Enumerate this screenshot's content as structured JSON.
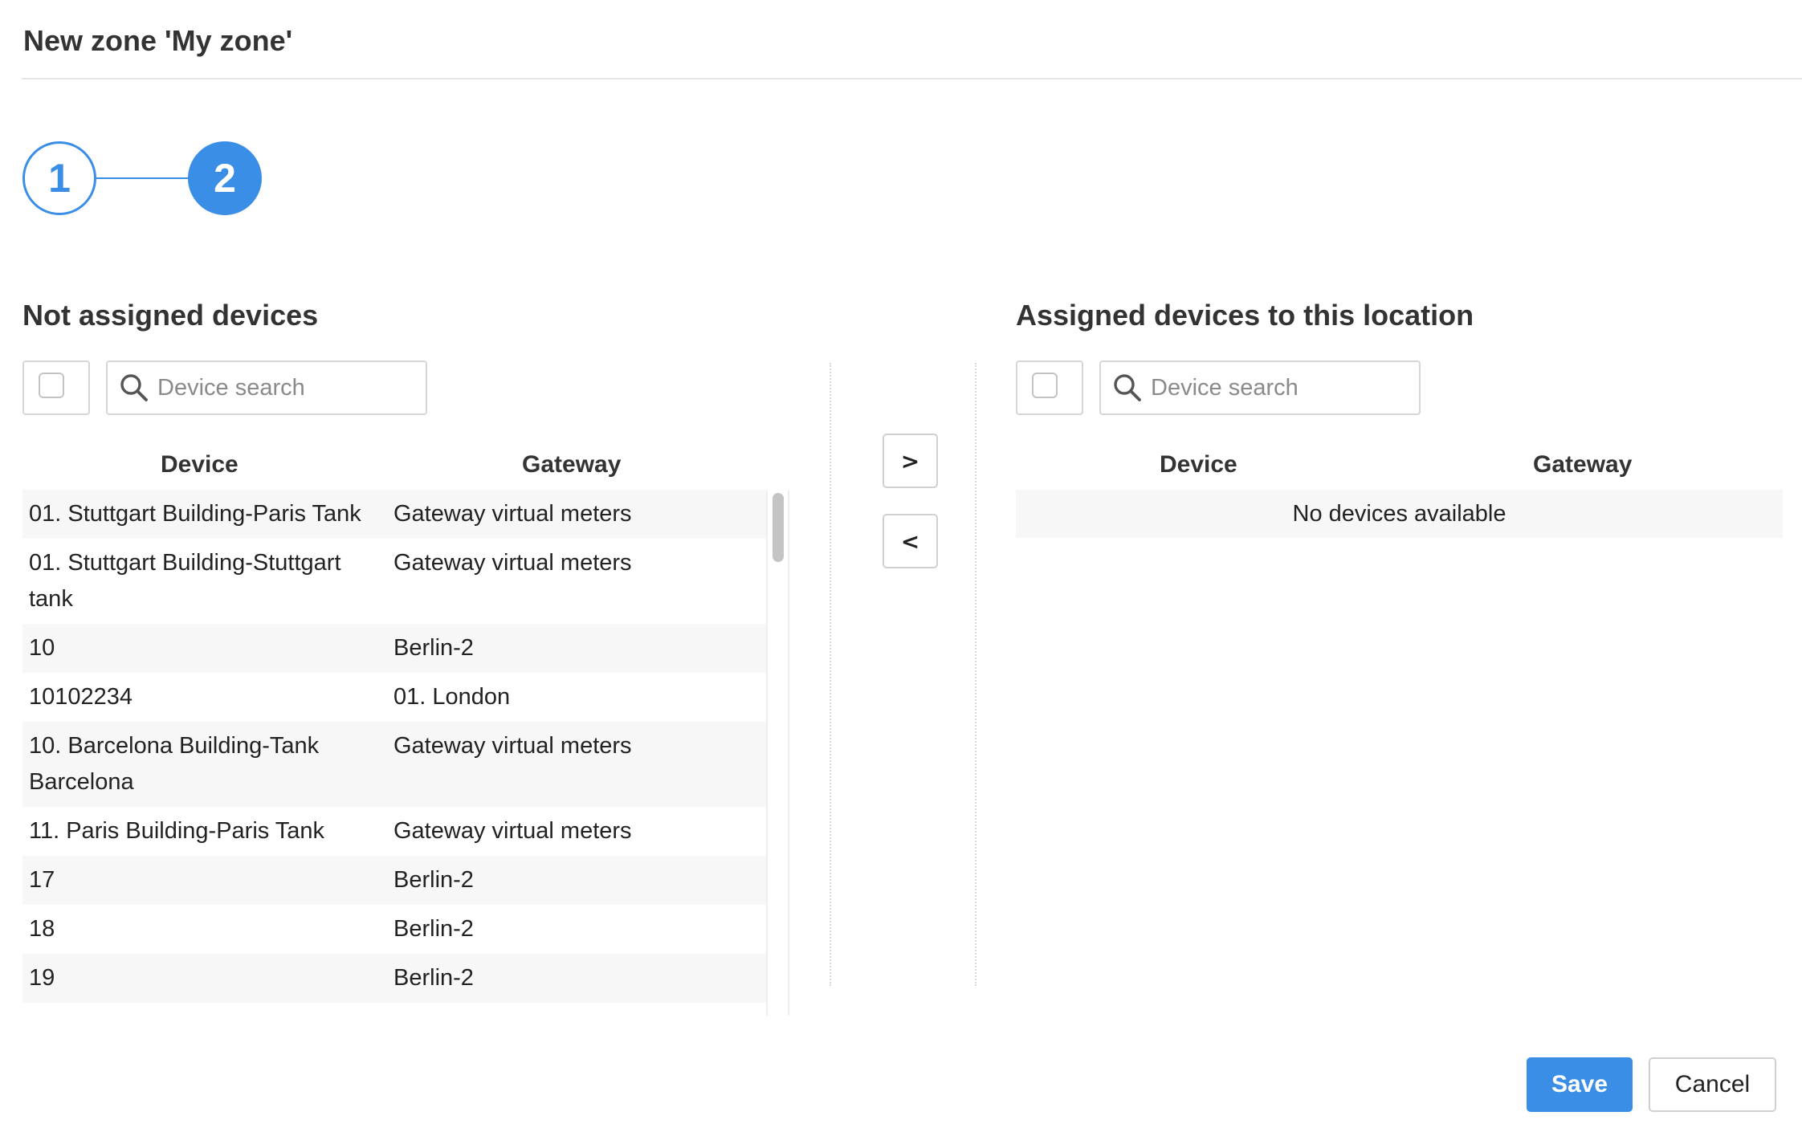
{
  "dialog": {
    "title": "New zone 'My zone'"
  },
  "stepper": {
    "steps": [
      "1",
      "2"
    ],
    "current_step": 2
  },
  "left_panel": {
    "title": "Not assigned devices",
    "search_placeholder": "Device search",
    "columns": {
      "device": "Device",
      "gateway": "Gateway"
    },
    "rows": [
      {
        "device": "01. Stuttgart Building-Paris Tank",
        "gateway": "Gateway virtual meters"
      },
      {
        "device": "01. Stuttgart Building-Stuttgart tank",
        "gateway": "Gateway virtual meters"
      },
      {
        "device": "10",
        "gateway": "Berlin-2"
      },
      {
        "device": "10102234",
        "gateway": "01. London"
      },
      {
        "device": "10. Barcelona Building-Tank Barcelona",
        "gateway": "Gateway virtual meters"
      },
      {
        "device": "11. Paris Building-Paris Tank",
        "gateway": "Gateway virtual meters"
      },
      {
        "device": "17",
        "gateway": "Berlin-2"
      },
      {
        "device": "18",
        "gateway": "Berlin-2"
      },
      {
        "device": "19",
        "gateway": "Berlin-2"
      }
    ]
  },
  "transfer": {
    "assign_label": ">",
    "unassign_label": "<"
  },
  "right_panel": {
    "title": "Assigned devices to this location",
    "search_placeholder": "Device search",
    "columns": {
      "device": "Device",
      "gateway": "Gateway"
    },
    "empty_text": "No devices available"
  },
  "footer": {
    "save_label": "Save",
    "cancel_label": "Cancel"
  },
  "colors": {
    "accent": "#3a8ee6"
  },
  "icons": {
    "search": "search-icon"
  }
}
